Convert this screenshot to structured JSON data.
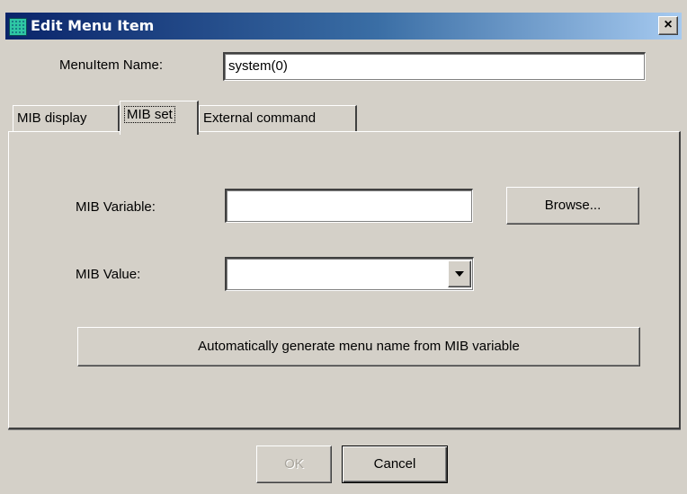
{
  "window": {
    "title": "Edit Menu Item",
    "close_label": "×",
    "icon": "grid-app-icon"
  },
  "menu_item_name": {
    "label": "MenuItem Name:",
    "value": "system(0)"
  },
  "tabs": [
    {
      "label": "MIB display",
      "selected": false
    },
    {
      "label": "MIB set",
      "selected": true
    },
    {
      "label": "External command",
      "selected": false
    }
  ],
  "mib_set": {
    "variable_label": "MIB Variable:",
    "variable_value": "",
    "browse_label": "Browse...",
    "value_label": "MIB Value:",
    "value_selected": "",
    "auto_generate_label": "Automatically generate menu name from MIB variable"
  },
  "footer": {
    "ok_label": "OK",
    "ok_enabled": false,
    "cancel_label": "Cancel"
  },
  "colors": {
    "title_start": "#0a246a",
    "title_end": "#a6caf0",
    "face": "#d4d0c8"
  }
}
